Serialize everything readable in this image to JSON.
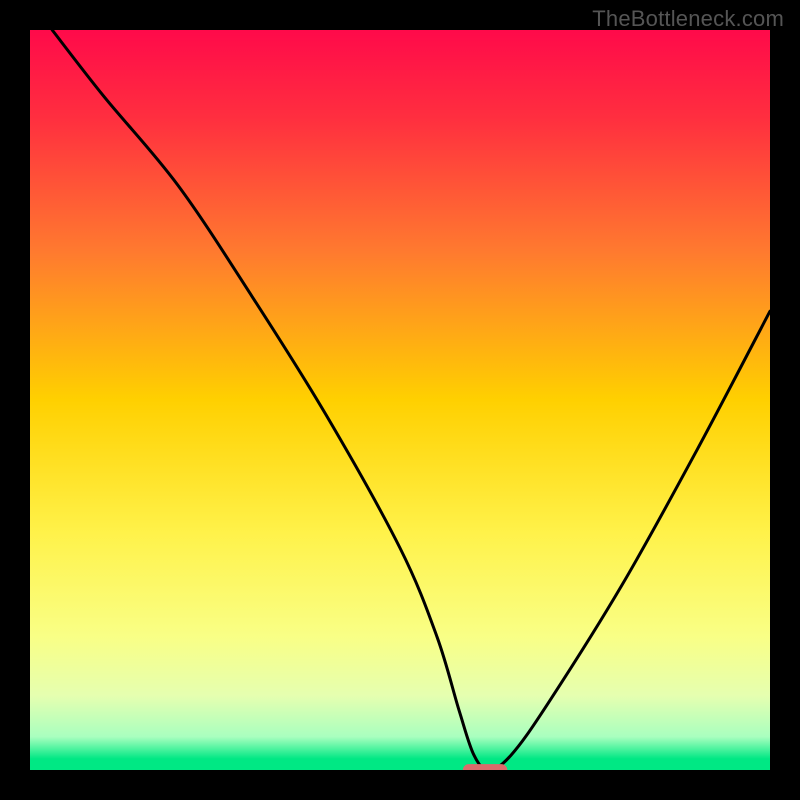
{
  "watermark": {
    "text": "TheBottleneck.com"
  },
  "chart_data": {
    "type": "line",
    "title": "",
    "xlabel": "",
    "ylabel": "",
    "xlim": [
      0,
      100
    ],
    "ylim": [
      0,
      100
    ],
    "grid": false,
    "legend": false,
    "background": {
      "type": "vertical-gradient",
      "stops": [
        {
          "offset": 0.0,
          "color": "#ff0a4a"
        },
        {
          "offset": 0.12,
          "color": "#ff2f3f"
        },
        {
          "offset": 0.3,
          "color": "#ff7a2f"
        },
        {
          "offset": 0.5,
          "color": "#ffd000"
        },
        {
          "offset": 0.68,
          "color": "#fff24a"
        },
        {
          "offset": 0.82,
          "color": "#f9ff86"
        },
        {
          "offset": 0.9,
          "color": "#e5ffb0"
        },
        {
          "offset": 0.955,
          "color": "#a9ffbf"
        },
        {
          "offset": 0.985,
          "color": "#00e884"
        },
        {
          "offset": 1.0,
          "color": "#00e884"
        }
      ]
    },
    "series": [
      {
        "name": "bottleneck-curve",
        "smooth": true,
        "x": [
          3,
          10,
          20,
          30,
          40,
          50,
          55,
          58,
          60,
          62,
          65,
          70,
          80,
          90,
          100
        ],
        "y": [
          100,
          91,
          79,
          64,
          48,
          30,
          18,
          8,
          2,
          0,
          2,
          9,
          25,
          43,
          62
        ]
      }
    ],
    "marker": {
      "shape": "pill",
      "color": "#db6b6b",
      "x": 61.5,
      "y": 0,
      "width": 6,
      "height": 1.6
    }
  }
}
